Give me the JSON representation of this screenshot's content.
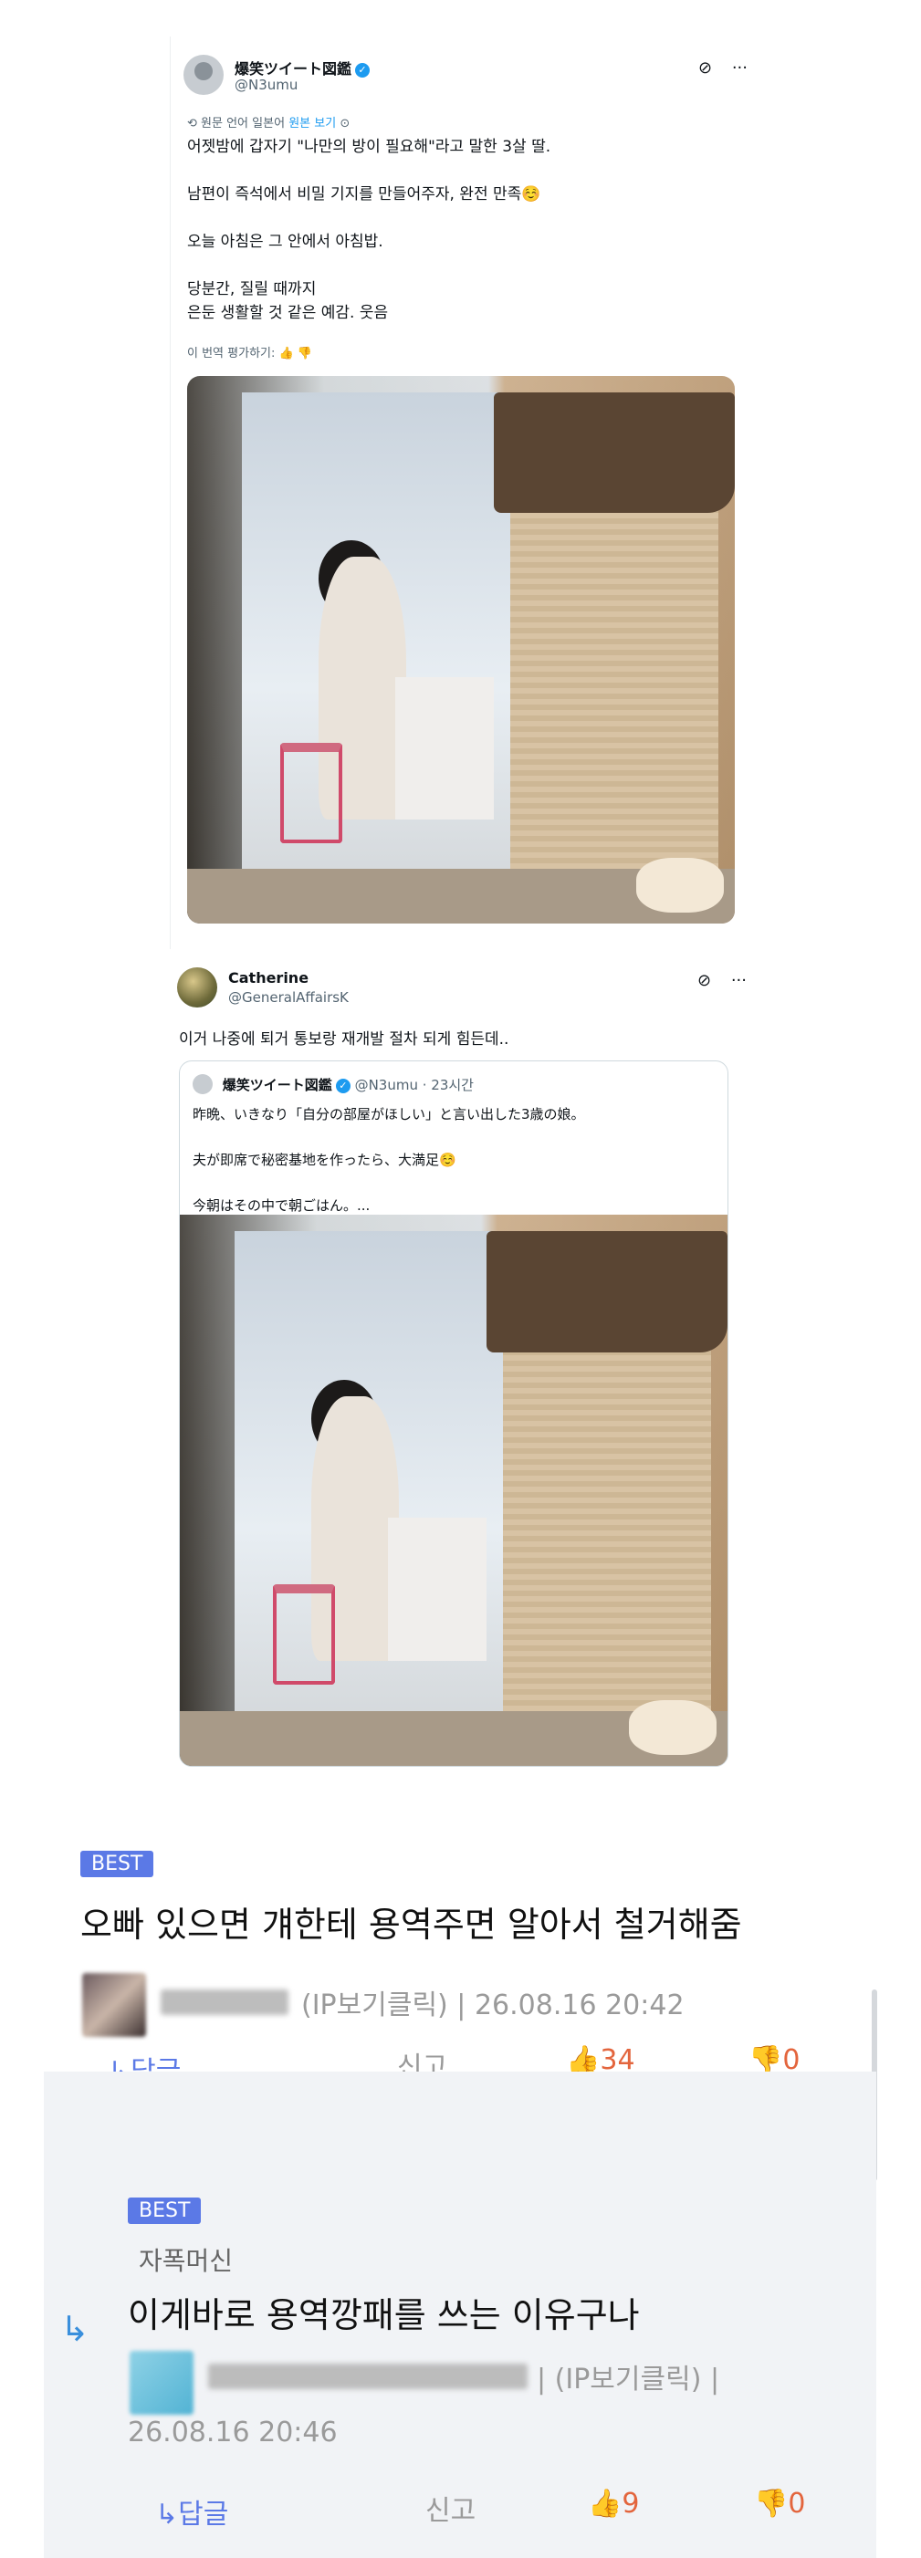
{
  "tweet1": {
    "name": "爆笑ツイート図鑑",
    "handle": "@N3umu",
    "translate_note": "원문 언어 일본어",
    "translate_link": "원본 보기",
    "body": "어젯밤에 갑자기 \"나만의 방이 필요해\"라고 말한 3살 딸.\n\n남편이 즉석에서 비밀 기지를 만들어주자, 완전 만족☺️\n\n오늘 아침은 그 안에서 아침밥.\n\n당분간, 질릴 때까지\n은둔 생활할 것 같은 예감. 웃음",
    "rate_label": "이 번역 평가하기:"
  },
  "tweet2": {
    "name": "Catherine",
    "handle": "@GeneralAffairsK",
    "comment": "이거 나중에 퇴거 통보랑 재개발 절차 되게 힘든데..",
    "quote": {
      "name": "爆笑ツイート図鑑",
      "handle": "@N3umu · 23시간",
      "body": "昨晩、いきなり「自分の部屋がほしい」と言い出した3歳の娘。\n\n夫が即席で秘密基地を作ったら、大満足☺️\n\n今朝はその中で朝ごはん。..."
    }
  },
  "icons": {
    "grok": "⊘",
    "more": "···",
    "translate": "⟲",
    "info": "⊙",
    "thumbs_up": "👍",
    "thumbs_down": "👎",
    "reply_arrow": "↳"
  },
  "comments": [
    {
      "badge": "BEST",
      "text": "오빠 있으면 걔한테 용역주면 알아서 철거해줌",
      "ip": "(IP보기클릭)",
      "date": "26.08.16 20:42",
      "reply_label": "↳답글",
      "report_label": "신고",
      "likes": "34",
      "dislikes": "0"
    },
    {
      "badge": "BEST",
      "author": "자폭머신",
      "text": "이게바로 용역깡패를 쓰는 이유구나",
      "ip": "(IP보기클릭)",
      "date": "26.08.16 20:46",
      "reply_label": "↳답글",
      "report_label": "신고",
      "likes": "9",
      "dislikes": "0"
    }
  ],
  "colors": {
    "badge": "#5b79e6",
    "reply": "#5b79e6",
    "vote": "#e3653d",
    "sub_bg": "#f1f3f6"
  }
}
